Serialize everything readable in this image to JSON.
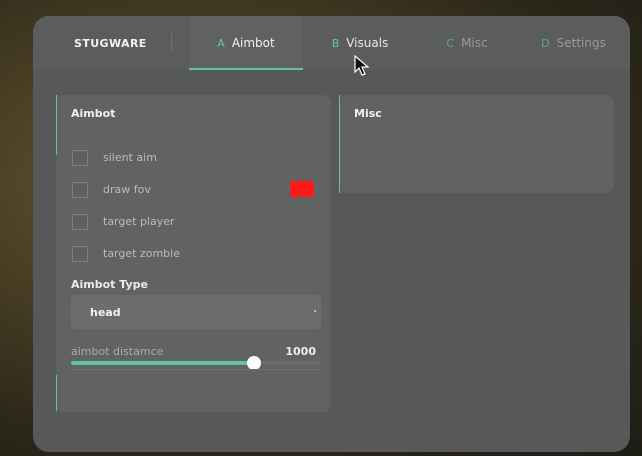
{
  "app": {
    "brand": "STUGWARE"
  },
  "tabs": [
    {
      "letter": "A",
      "label": "Aimbot",
      "active": true
    },
    {
      "letter": "B",
      "label": "Visuals",
      "active": false
    },
    {
      "letter": "C",
      "label": "Misc",
      "active": false
    },
    {
      "letter": "D",
      "label": "Settings",
      "active": false
    }
  ],
  "aimbot_panel": {
    "title": "Aimbot",
    "checkboxes": [
      {
        "label": "silent aim",
        "checked": false
      },
      {
        "label": "draw fov",
        "checked": false,
        "color": "#ff1a1a"
      },
      {
        "label": "target player",
        "checked": false
      },
      {
        "label": "target zombie",
        "checked": false
      }
    ],
    "type_label": "Aimbot Type",
    "type_value": "head",
    "slider": {
      "label": "aimbot distamce",
      "value": "1000",
      "fill_fraction": 0.73
    }
  },
  "misc_panel": {
    "title": "Misc"
  },
  "colors": {
    "accent": "#63c4a4",
    "window": "#575959",
    "panel": "#616363"
  }
}
